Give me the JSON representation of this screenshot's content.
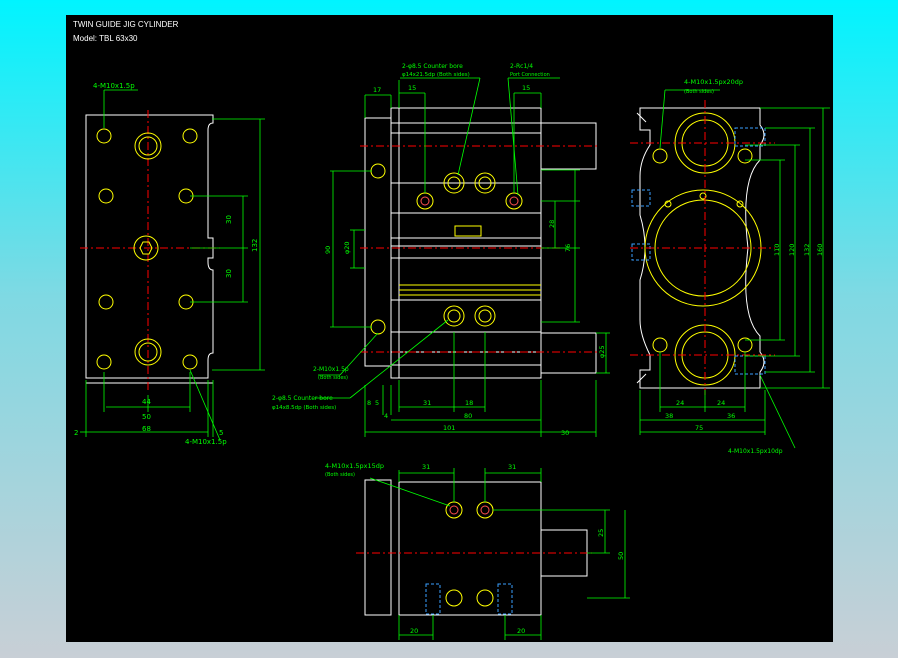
{
  "title": "TWIN GUIDE JIG CYLINDER",
  "model": "Model: TBL 63x30",
  "colors": {
    "background": "#000000",
    "outline": "#ffffff",
    "hole": "#ffff00",
    "dimension": "#00ff00",
    "center": "#ff0000",
    "hidden": "#3aa0ff",
    "thread": "#ff5050"
  },
  "left_view": {
    "callout_top": "4-M10x1.5p",
    "callout_bottom": "4-M10x1.5p",
    "dim_30a": "30",
    "dim_30b": "30",
    "dim_132": "132",
    "dim_44": "44",
    "dim_50": "50",
    "dim_68": "68",
    "dim_2": "2",
    "dim_5": "5"
  },
  "center_view": {
    "callout_counterbore": "2-φ8.5 Counter bore",
    "callout_counterbore_sub": "φ14x21.5dp (Both sides)",
    "callout_port": "2-Rc1/4",
    "callout_port_sub": "Port Connection",
    "callout_m10": "2-M10x1.5p",
    "callout_m10_sub": "(Both sides)",
    "callout_cb2": "2-φ8.5 Counter bore",
    "callout_cb2_sub": "φ14x8.5dp (Both sides)",
    "dim_17": "17",
    "dim_15a": "15",
    "dim_15b": "15",
    "dim_28": "28",
    "dim_76": "76",
    "dim_90": "90",
    "dim_phi20": "φ20",
    "dim_phi25": "φ25",
    "dim_8": "8",
    "dim_5": "5",
    "dim_4": "4",
    "dim_31": "31",
    "dim_18": "18",
    "dim_80": "80",
    "dim_101": "101",
    "dim_30": "30"
  },
  "right_view": {
    "callout_top": "4-M10x1.5px20dp",
    "callout_top_sub": "(Both sides)",
    "callout_bottom": "4-M10x1.5px10dp",
    "dim_110": "110",
    "dim_120": "120",
    "dim_132": "132",
    "dim_160": "160",
    "dim_24a": "24",
    "dim_24b": "24",
    "dim_38": "38",
    "dim_36": "36",
    "dim_75": "75"
  },
  "bottom_view": {
    "callout": "4-M10x1.5px15dp",
    "callout_sub": "(Both sides)",
    "dim_31a": "31",
    "dim_31b": "31",
    "dim_25": "25",
    "dim_50": "50",
    "dim_20a": "20",
    "dim_20b": "20"
  }
}
